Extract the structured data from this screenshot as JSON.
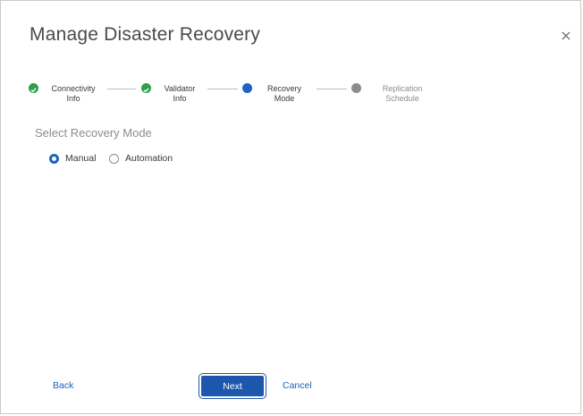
{
  "dialog": {
    "title": "Manage Disaster Recovery",
    "close_icon": "close-icon"
  },
  "stepper": {
    "steps": [
      {
        "label": "Connectivity\nInfo",
        "status": "completed"
      },
      {
        "label": "Validator\nInfo",
        "status": "completed"
      },
      {
        "label": "Recovery\nMode",
        "status": "current"
      },
      {
        "label": "Replication\nSchedule",
        "status": "upcoming"
      }
    ]
  },
  "recovery_mode": {
    "title": "Select Recovery Mode",
    "options": [
      {
        "label": "Manual",
        "selected": true
      },
      {
        "label": "Automation",
        "selected": false
      }
    ]
  },
  "footer": {
    "back_label": "Back",
    "next_label": "Next",
    "cancel_label": "Cancel"
  },
  "colors": {
    "completed": "#2aa14b",
    "current": "#1f63c1",
    "upcoming": "#8c8c8c",
    "primary": "#1d57ad",
    "link": "#1a61b7"
  }
}
